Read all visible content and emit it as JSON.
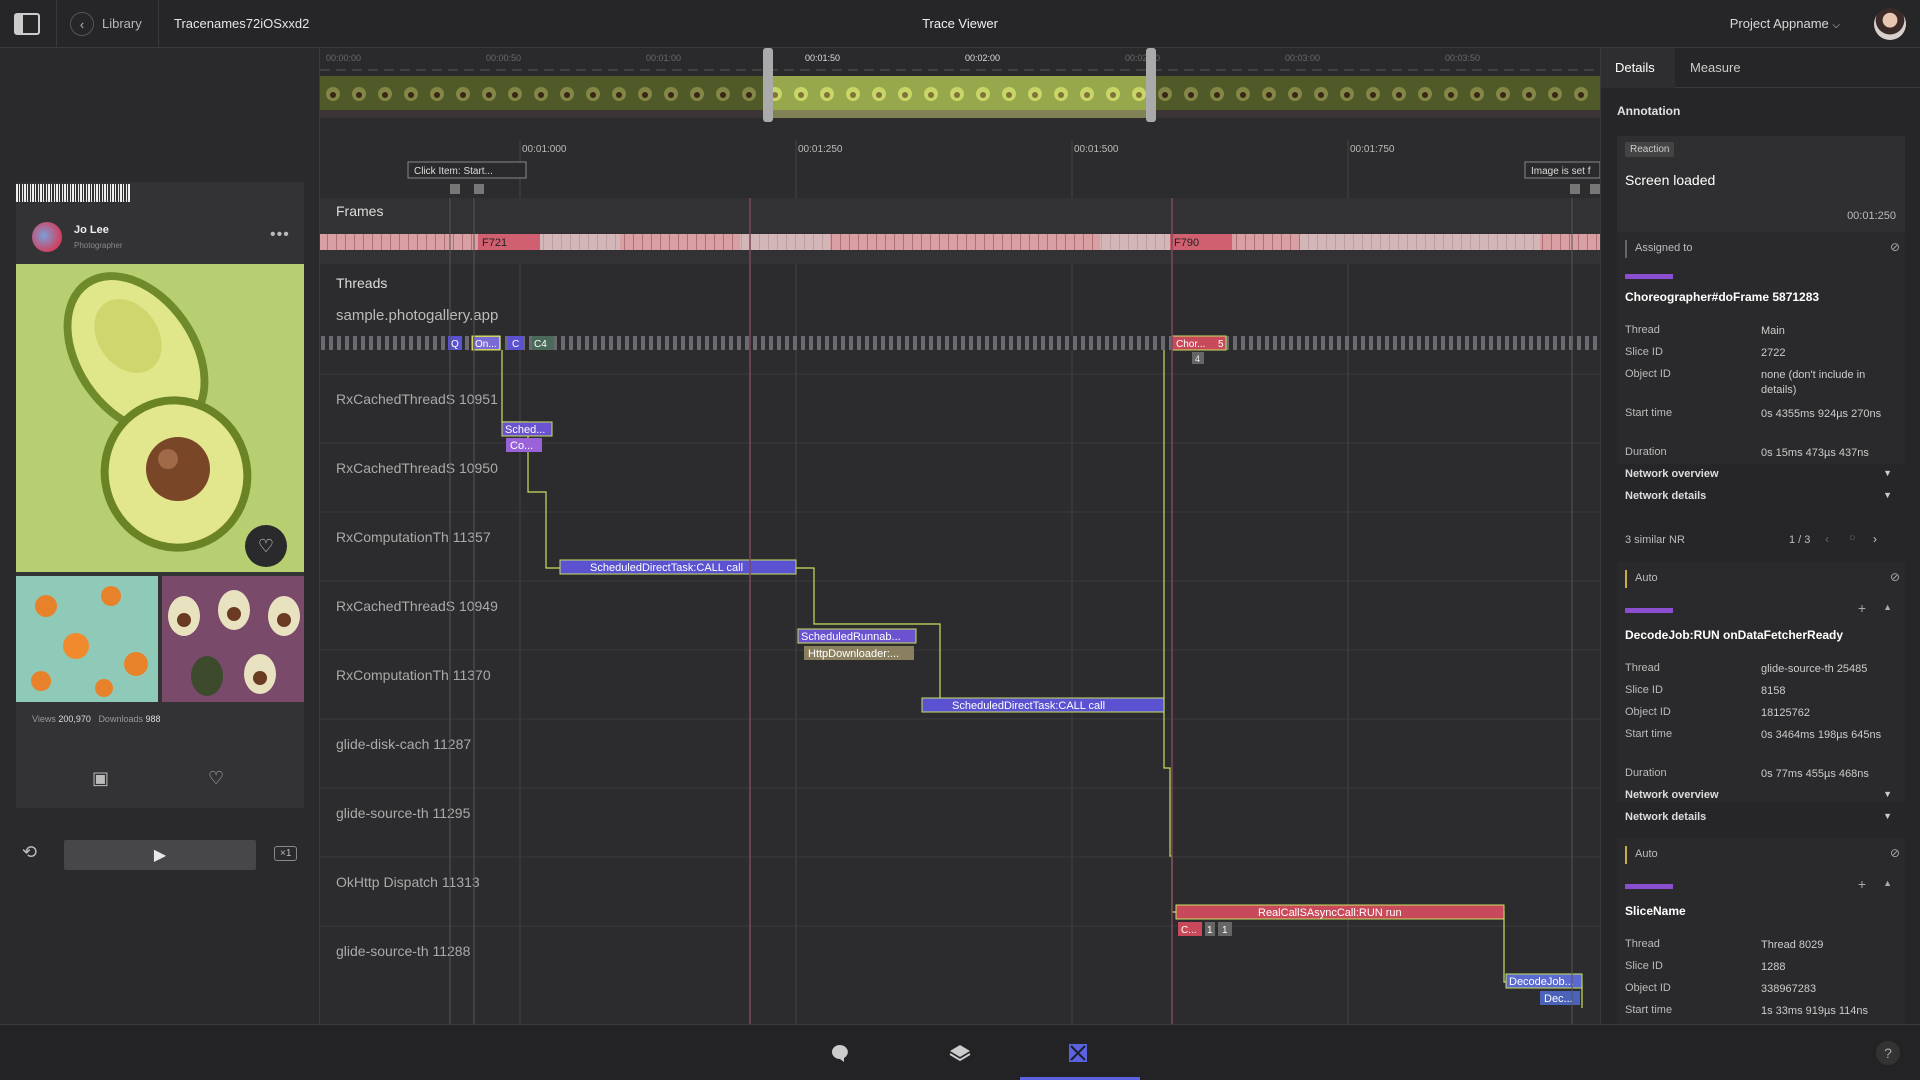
{
  "header": {
    "library": "Library",
    "filename": "Tracenames72iOSxxd2",
    "title": "Trace Viewer",
    "project": "Project Appname"
  },
  "left": {
    "user_name": "Jo Lee",
    "user_role": "Photographer",
    "views_label": "Views",
    "views": "200,970",
    "downloads_label": "Downloads",
    "downloads": "988",
    "speed": "×1"
  },
  "timeline": {
    "top_ticks": [
      "00:00:00",
      "00:00:50",
      "00:01:00",
      "00:01:50",
      "00:02:00",
      "00:02:50",
      "00:03:00",
      "00:03:50"
    ],
    "sub_ticks": [
      "00:01:000",
      "00:01:250",
      "00:01:500",
      "00:01:750"
    ],
    "marker_left": "Click Item: Start...",
    "marker_right": "Image is set f"
  },
  "tracks": {
    "frames": "Frames",
    "threads": "Threads",
    "app": "sample.photogallery.app",
    "f721": "F721",
    "f790": "F790",
    "thread_names": [
      "RxCachedThreadS 10951",
      "RxCachedThreadS 10950",
      "RxComputationTh 11357",
      "RxCachedThreadS 10949",
      "RxComputationTh 11370",
      "glide-disk-cach 11287",
      "glide-source-th 11295",
      "OkHttp Dispatch 11313",
      "glide-source-th 11288"
    ]
  },
  "slices": {
    "q": "Q",
    "on": "On...",
    "c": "C",
    "c4": "C4",
    "chor": "Chor...",
    "five": "5",
    "four": "4",
    "sched": "Sched...",
    "co": "Co...",
    "sdt1": "ScheduledDirectTask:CALL call",
    "sr": "ScheduledRunnab...",
    "http": "HttpDownloader:...",
    "sdt2": "ScheduledDirectTask:CALL call",
    "realcall": "RealCallSAsyncCall:RUN run",
    "c_small": "C...",
    "one_a": "1",
    "one_b": "1",
    "decode": "DecodeJob...",
    "dec": "Dec..."
  },
  "details": {
    "tab_details": "Details",
    "tab_measure": "Measure",
    "annotation": "Annotation",
    "reaction": "Reaction",
    "ann_title": "Screen loaded",
    "ann_time": "00:01:250",
    "assigned": "Assigned to",
    "lbl_thread": "Thread",
    "lbl_slice": "Slice ID",
    "lbl_object": "Object ID",
    "lbl_start": "Start time",
    "lbl_duration": "Duration",
    "net_overview": "Network overview",
    "net_details": "Network details",
    "similar": "3 similar NR",
    "similar_page": "1 / 3",
    "auto": "Auto",
    "b1": {
      "name": "Choreographer#doFrame 5871283",
      "thread": "Main",
      "slice": "2722",
      "object": "none (don't include in details)",
      "start": "0s 4355ms 924µs 270ns",
      "duration": "0s 15ms 473µs 437ns"
    },
    "b2": {
      "name": "DecodeJob:RUN onDataFetcherReady",
      "thread": "glide-source-th 25485",
      "slice": "8158",
      "object": "18125762",
      "start": "0s 3464ms 198µs 645ns",
      "duration": "0s 77ms 455µs 468ns"
    },
    "b3": {
      "name": "SliceName",
      "thread": "Thread 8029",
      "slice": "1288",
      "object": "338967283",
      "start": "1s 33ms 919µs 114ns"
    }
  },
  "colors": {
    "accent": "#8a4fd0",
    "slice_blue": "#5a52d0",
    "slice_red": "#c84a5a",
    "highlight": "#c8e060"
  },
  "icons": [
    "sidebar-toggle-icon",
    "chevron-left-icon",
    "chevron-down-icon",
    "more-icon",
    "heart-icon",
    "image-icon",
    "repeat-icon",
    "play-icon",
    "link-off-icon",
    "plus-icon",
    "chevron-up-icon",
    "chat-icon",
    "layers-icon",
    "trace-icon",
    "help-icon"
  ]
}
